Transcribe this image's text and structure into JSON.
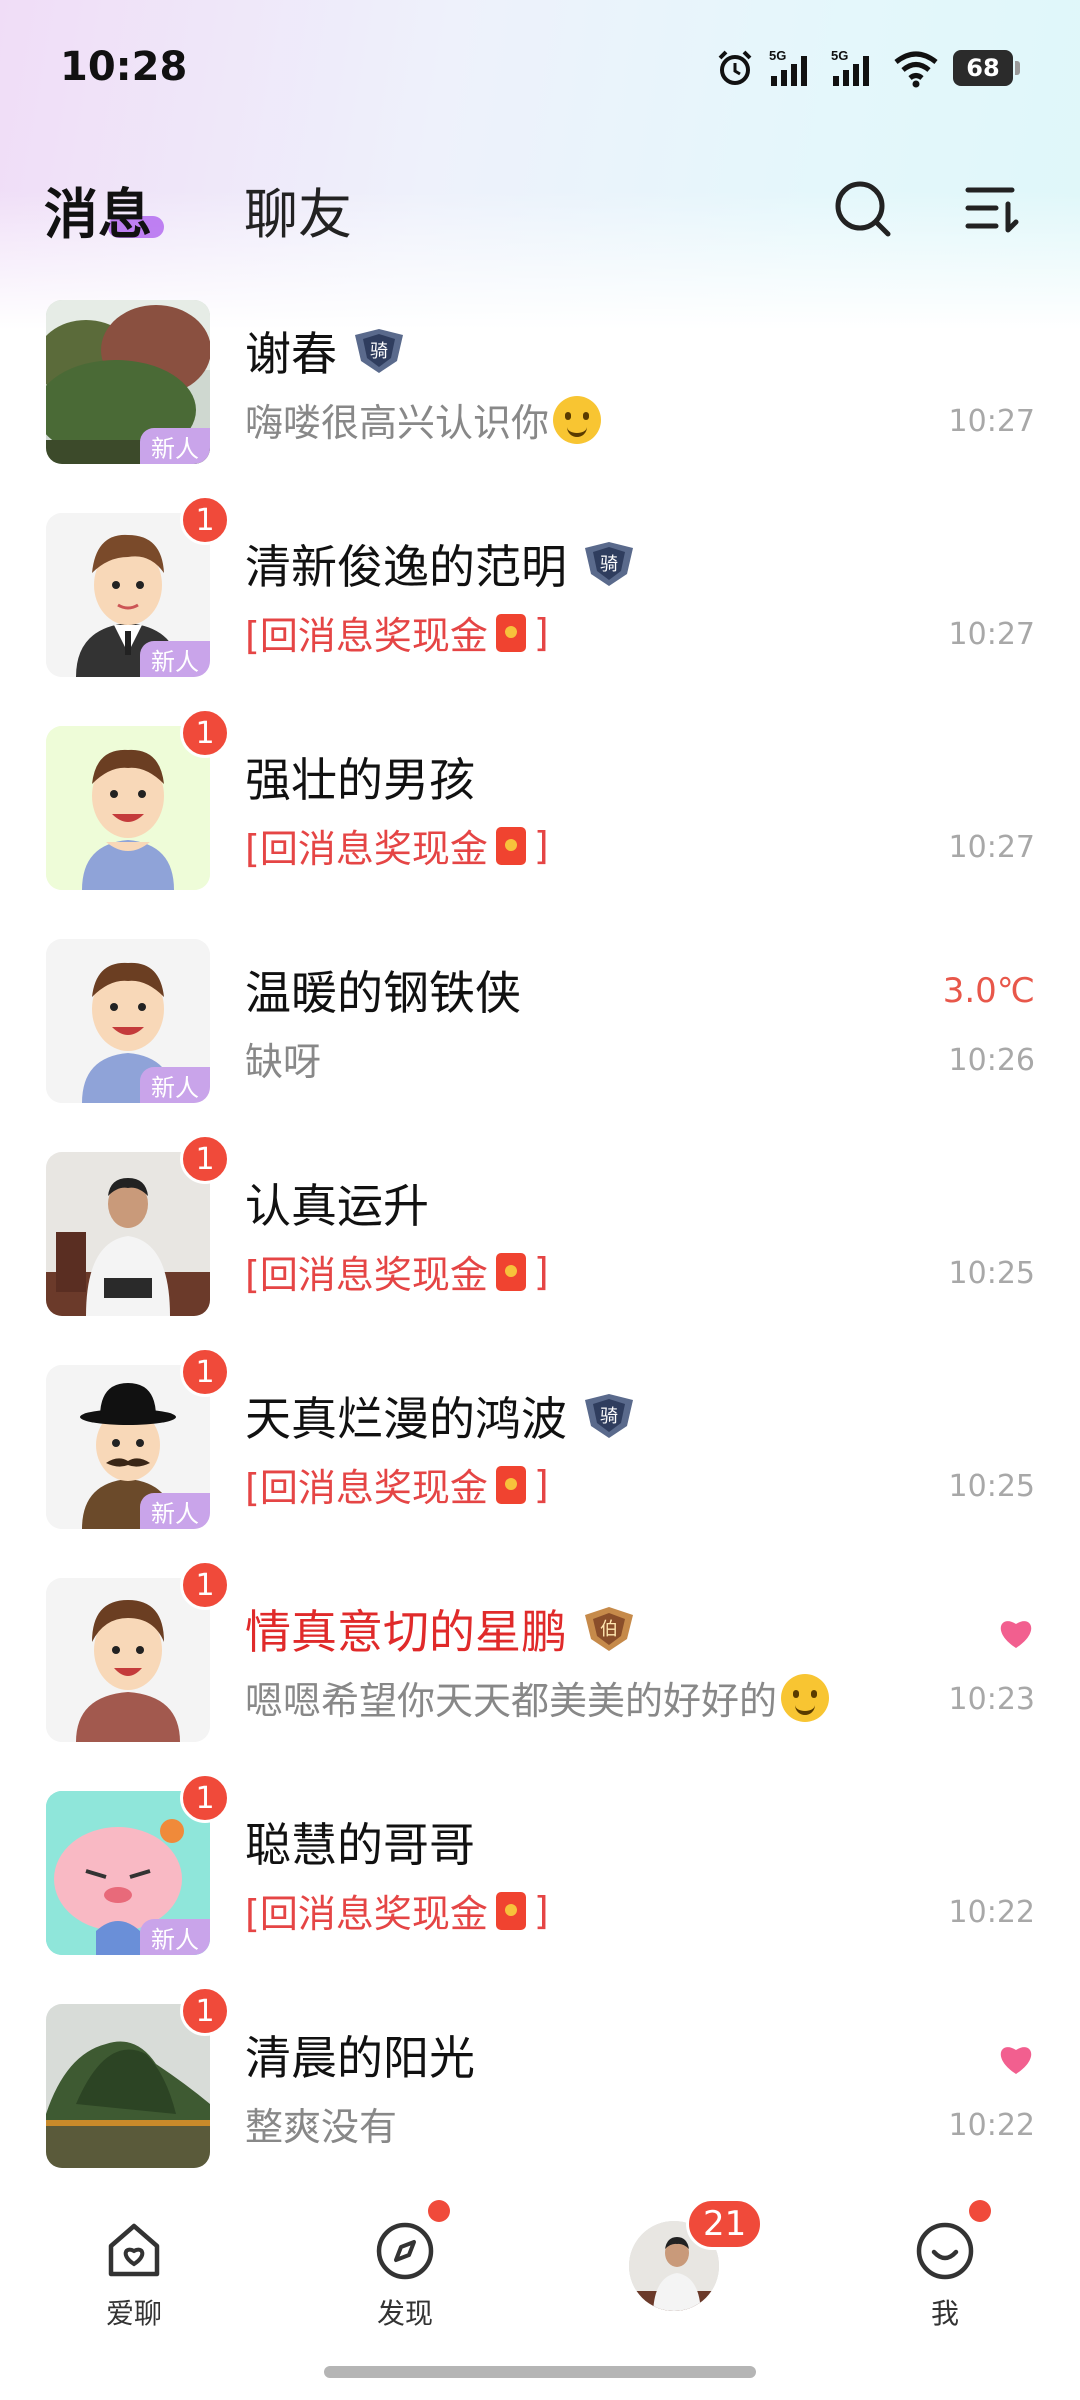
{
  "status_bar": {
    "time": "10:28",
    "signal_1_label": "5G",
    "signal_2_label": "5G",
    "battery": "68"
  },
  "header": {
    "tab_messages": "消息",
    "tab_friends": "聊友"
  },
  "new_tag": "新人",
  "conversations": [
    {
      "name": "谢春",
      "rank_label": "骑",
      "preview": "嗨喽很高兴认识你",
      "time": "10:27",
      "badge": "",
      "new_user": true,
      "avatar": "trees-photo"
    },
    {
      "name": "清新俊逸的范明",
      "rank_label": "骑",
      "preview": "[回消息奖现金",
      "preview_end": "]",
      "time": "10:27",
      "badge": "1",
      "new_user": true,
      "avatar": "cartoon-man-suit"
    },
    {
      "name": "强壮的男孩",
      "preview": "[回消息奖现金",
      "preview_end": "]",
      "time": "10:27",
      "badge": "1",
      "new_user": false,
      "avatar": "cartoon-boy-tank"
    },
    {
      "name": "温暖的钢铁侠",
      "preview": "缺呀",
      "time": "10:26",
      "extra": "3.0℃",
      "badge": "",
      "new_user": true,
      "avatar": "cartoon-boy-tank"
    },
    {
      "name": "认真运升",
      "preview": "[回消息奖现金",
      "preview_end": "]",
      "time": "10:25",
      "badge": "1",
      "new_user": false,
      "avatar": "man-photo"
    },
    {
      "name": "天真烂漫的鸿波",
      "rank_label": "骑",
      "preview": "[回消息奖现金",
      "preview_end": "]",
      "time": "10:25",
      "badge": "1",
      "new_user": true,
      "avatar": "cartoon-man-hat"
    },
    {
      "name": "情真意切的星鹏",
      "rank_label": "伯",
      "preview": "嗯嗯希望你天天都美美的好好的",
      "time": "10:23",
      "badge": "1",
      "new_user": false,
      "heart": true,
      "avatar": "cartoon-boy-shirt"
    },
    {
      "name": "聪慧的哥哥",
      "preview": "[回消息奖现金",
      "preview_end": "]",
      "time": "10:22",
      "badge": "1",
      "new_user": true,
      "avatar": "pink-cartoon"
    },
    {
      "name": "清晨的阳光",
      "preview": "整爽没有",
      "time": "10:22",
      "badge": "1",
      "new_user": false,
      "heart": true,
      "avatar": "lake-photo"
    }
  ],
  "bottom_nav": {
    "item1": "爱聊",
    "item2": "发现",
    "center_count": "21",
    "item4": "我"
  },
  "colors": {
    "accent_purple": "#b46cf0",
    "badge_red": "#f04a3a",
    "reward_red": "#e54545",
    "highlight_name": "#e02a2a",
    "heart_pink": "#f25f8f"
  }
}
